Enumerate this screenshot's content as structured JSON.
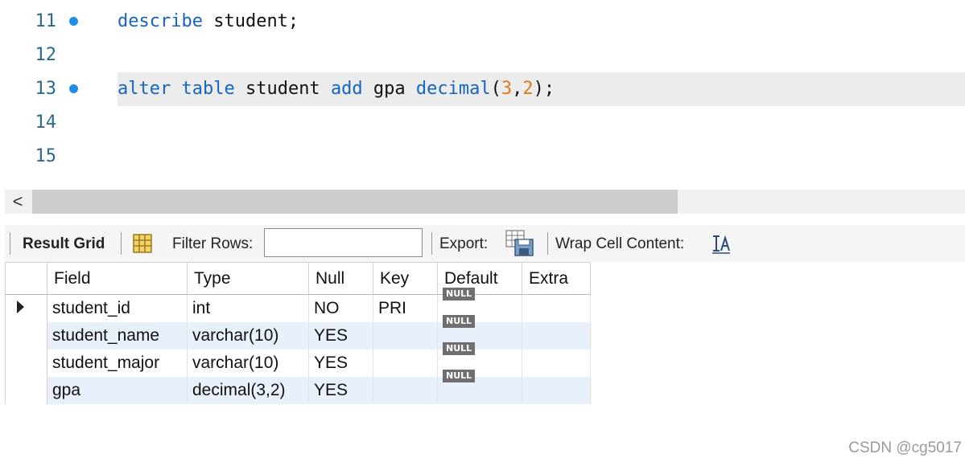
{
  "editor": {
    "lines": [
      {
        "number": "11",
        "marker": true,
        "tokens": [
          {
            "t": "describe",
            "c": "kw"
          },
          {
            "t": " student;",
            "c": "plain"
          }
        ]
      },
      {
        "number": "12",
        "marker": false,
        "tokens": []
      },
      {
        "number": "13",
        "marker": true,
        "current": true,
        "tokens": [
          {
            "t": "alter",
            "c": "kw"
          },
          {
            "t": " ",
            "c": "plain"
          },
          {
            "t": "table",
            "c": "kw"
          },
          {
            "t": " student ",
            "c": "plain"
          },
          {
            "t": "add",
            "c": "kw"
          },
          {
            "t": " gpa ",
            "c": "plain"
          },
          {
            "t": "decimal",
            "c": "kw"
          },
          {
            "t": "(",
            "c": "plain"
          },
          {
            "t": "3",
            "c": "num"
          },
          {
            "t": ",",
            "c": "plain"
          },
          {
            "t": "2",
            "c": "num"
          },
          {
            "t": ");",
            "c": "plain"
          }
        ]
      },
      {
        "number": "14",
        "marker": false,
        "tokens": []
      },
      {
        "number": "15",
        "marker": false,
        "tokens": []
      }
    ],
    "colors": {
      "keyword": "#1565c0",
      "number": "#e07a1f",
      "marker": "#1f8de6"
    }
  },
  "scrollbar": {
    "left_arrow": "<"
  },
  "toolbar": {
    "result_grid_label": "Result Grid",
    "grid_icon": "grid-view-icon",
    "filter_label": "Filter Rows:",
    "filter_value": "",
    "export_label": "Export:",
    "export_icon": "export-save-icon",
    "wrap_label": "Wrap Cell Content:",
    "wrap_icon": "wrap-text-icon"
  },
  "grid": {
    "columns": [
      "Field",
      "Type",
      "Null",
      "Key",
      "Default",
      "Extra"
    ],
    "rows": [
      {
        "field": "student_id",
        "type": "int",
        "null": "NO",
        "key": "PRI",
        "default": "NULL",
        "extra": ""
      },
      {
        "field": "student_name",
        "type": "varchar(10)",
        "null": "YES",
        "key": "",
        "default": "NULL",
        "extra": ""
      },
      {
        "field": "student_major",
        "type": "varchar(10)",
        "null": "YES",
        "key": "",
        "default": "NULL",
        "extra": ""
      },
      {
        "field": "gpa",
        "type": "decimal(3,2)",
        "null": "YES",
        "key": "",
        "default": "NULL",
        "extra": ""
      }
    ],
    "selected_row_index": 0
  },
  "watermark": "CSDN @cg5017"
}
